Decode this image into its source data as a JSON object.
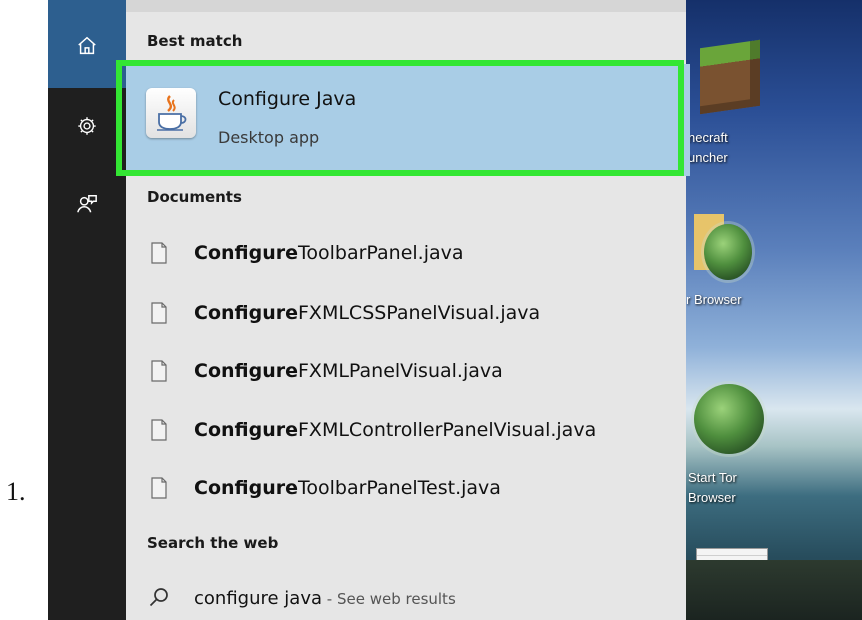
{
  "list_number": "1.",
  "desktop": {
    "icons": [
      {
        "label_line1": "necraft",
        "label_line2": "uncher"
      },
      {
        "label_line1": "r Browser",
        "label_line2": ""
      },
      {
        "label_line1": "Start Tor",
        "label_line2": "Browser"
      }
    ],
    "watermark_prefix": "wiki",
    "watermark_suffix": "How"
  },
  "sidebar": {
    "items": [
      {
        "icon": "home-icon"
      },
      {
        "icon": "gear-icon"
      },
      {
        "icon": "feedback-icon"
      }
    ]
  },
  "results": {
    "best_match_heading": "Best match",
    "best_match": {
      "title": "Configure Java",
      "subtitle": "Desktop app",
      "icon": "java-icon"
    },
    "documents_heading": "Documents",
    "documents": [
      {
        "highlight": "Configure",
        "rest": "ToolbarPanel.java"
      },
      {
        "highlight": "Configure",
        "rest": "FXMLCSSPanelVisual.java"
      },
      {
        "highlight": "Configure",
        "rest": "FXMLPanelVisual.java"
      },
      {
        "highlight": "Configure",
        "rest": "FXMLControllerPanelVisual.java"
      },
      {
        "highlight": "Configure",
        "rest": "ToolbarPanelTest.java"
      }
    ],
    "web_heading": "Search the web",
    "web": {
      "query": "configure java",
      "separator": " - ",
      "hint": "See web results"
    }
  },
  "colors": {
    "highlight_border": "#33e633",
    "best_match_bg": "#a9cde6",
    "panel_bg": "#e6e6e6",
    "sidebar_bg": "#1f1f1f",
    "sidebar_active": "#2d5f8f"
  }
}
